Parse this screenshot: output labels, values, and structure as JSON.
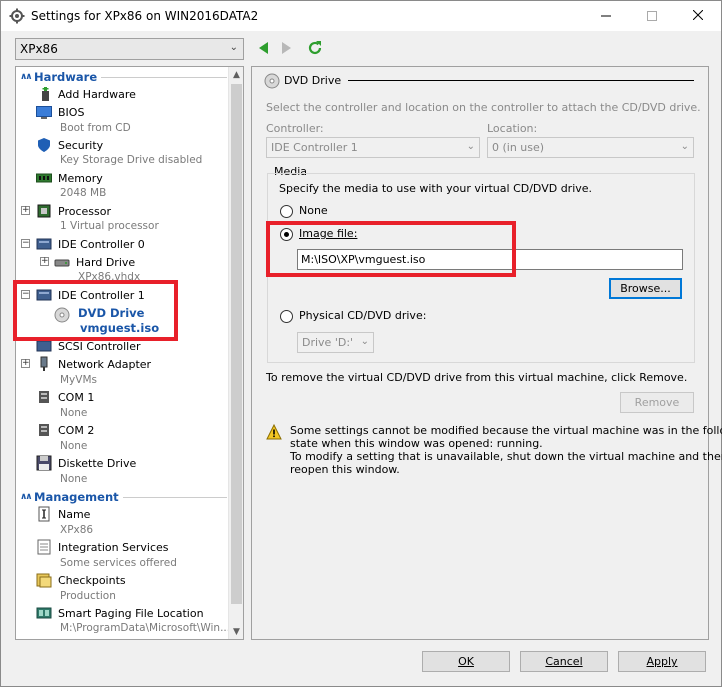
{
  "window": {
    "title": "Settings for XPx86 on WIN2016DATA2"
  },
  "vm_selector": {
    "value": "XPx86"
  },
  "tree": {
    "hardware_header": "Hardware",
    "management_header": "Management",
    "items": [
      {
        "label": "Add Hardware",
        "sub": ""
      },
      {
        "label": "BIOS",
        "sub": "Boot from CD"
      },
      {
        "label": "Security",
        "sub": "Key Storage Drive disabled"
      },
      {
        "label": "Memory",
        "sub": "2048 MB"
      },
      {
        "label": "Processor",
        "sub": "1 Virtual processor"
      },
      {
        "label": "IDE Controller 0",
        "sub": ""
      },
      {
        "label": "Hard Drive",
        "sub": "XPx86.vhdx"
      },
      {
        "label": "IDE Controller 1",
        "sub": ""
      },
      {
        "label": "DVD Drive",
        "sub": "vmguest.iso"
      },
      {
        "label": "SCSI Controller",
        "sub": ""
      },
      {
        "label": "Network Adapter",
        "sub": "MyVMs"
      },
      {
        "label": "COM 1",
        "sub": "None"
      },
      {
        "label": "COM 2",
        "sub": "None"
      },
      {
        "label": "Diskette Drive",
        "sub": "None"
      }
    ],
    "mgmt_items": [
      {
        "label": "Name",
        "sub": "XPx86"
      },
      {
        "label": "Integration Services",
        "sub": "Some services offered"
      },
      {
        "label": "Checkpoints",
        "sub": "Production"
      },
      {
        "label": "Smart Paging File Location",
        "sub": "M:\\ProgramData\\Microsoft\\Win..."
      }
    ]
  },
  "panel": {
    "title": "DVD Drive",
    "intro": "Select the controller and location on the controller to attach the CD/DVD drive.",
    "controller_label": "Controller:",
    "controller_value": "IDE Controller 1",
    "location_label": "Location:",
    "location_value": "0 (in use)",
    "media_label": "Media",
    "media_desc": "Specify the media to use with your virtual CD/DVD drive.",
    "none_label": "None",
    "image_label": "Image file:",
    "image_path": "M:\\ISO\\XP\\vmguest.iso",
    "browse_label": "Browse...",
    "physical_label": "Physical CD/DVD drive:",
    "physical_value": "Drive 'D:'",
    "remove_text": "To remove the virtual CD/DVD drive from this virtual machine, click Remove.",
    "remove_label": "Remove",
    "warning_line1": "Some settings cannot be modified because the virtual machine was in the following",
    "warning_line2": "state when this window was opened: running.",
    "warning_line3": "To modify a setting that is unavailable, shut down the virtual machine and then",
    "warning_line4": "reopen this window."
  },
  "buttons": {
    "ok": "OK",
    "cancel": "Cancel",
    "apply": "Apply"
  },
  "colors": {
    "accent": "#1a56a8",
    "highlight_box": "#e8202a",
    "nav_green": "#2e9e2e"
  }
}
